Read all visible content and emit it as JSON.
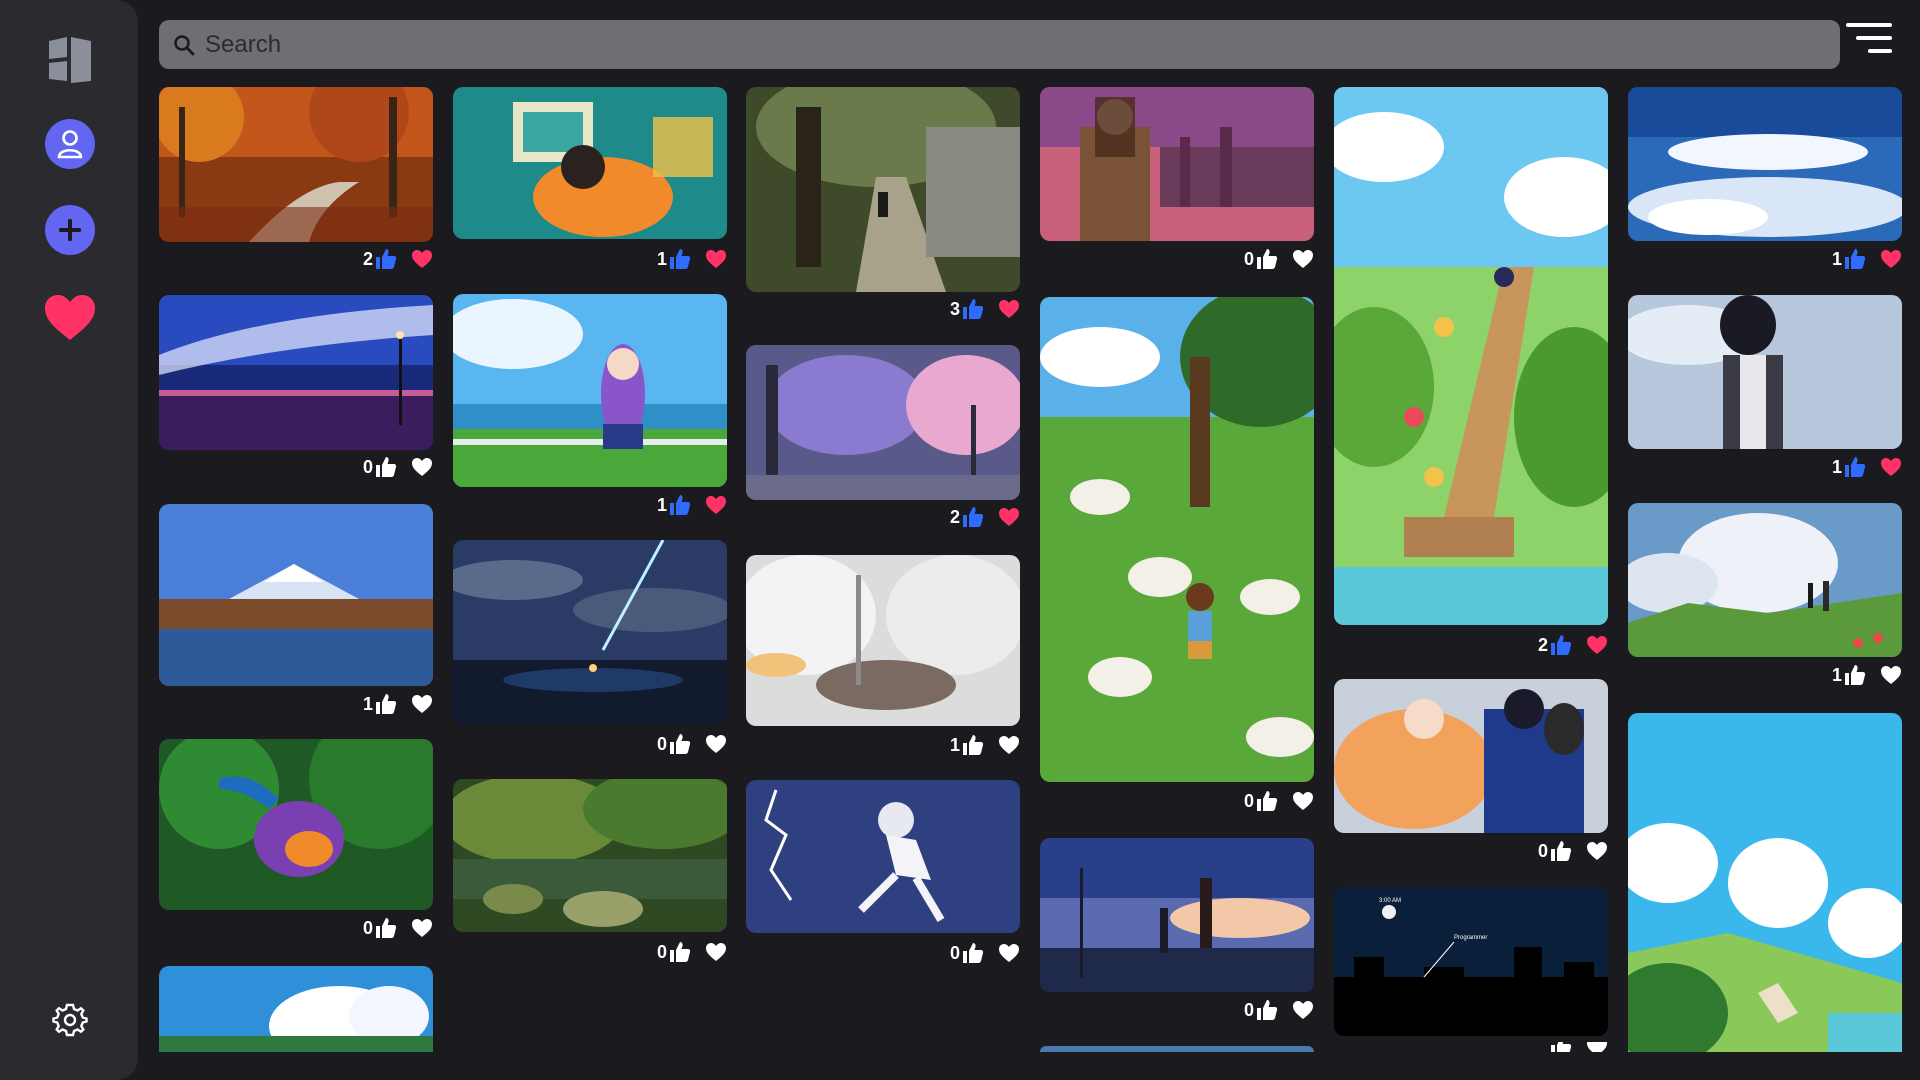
{
  "app": {
    "search_placeholder": "Search",
    "accent": "#6366f1",
    "heart_active": "#ff3366",
    "like_active": "#2f6bff"
  },
  "sidebar": {
    "items": [
      {
        "name": "logo-icon"
      },
      {
        "name": "profile-icon"
      },
      {
        "name": "add-icon"
      },
      {
        "name": "favorites-heart-icon"
      },
      {
        "name": "settings-gear-icon"
      }
    ]
  },
  "cards": [
    {
      "likes": "2",
      "liked": true,
      "favorited": true,
      "scene": "autumn park path"
    },
    {
      "likes": "0",
      "liked": false,
      "favorited": false,
      "scene": "starry evening sky"
    },
    {
      "likes": "1",
      "liked": false,
      "favorited": false,
      "scene": "mountain lake"
    },
    {
      "likes": "0",
      "liked": false,
      "favorited": false,
      "scene": "jungle bird"
    },
    {
      "likes": "",
      "liked": false,
      "favorited": false,
      "scene": "sky with clouds"
    },
    {
      "likes": "1",
      "liked": true,
      "favorited": true,
      "scene": "room with desk"
    },
    {
      "likes": "1",
      "liked": true,
      "favorited": true,
      "scene": "girl by the sea"
    },
    {
      "likes": "0",
      "liked": false,
      "favorited": false,
      "scene": "comet over town"
    },
    {
      "likes": "0",
      "liked": false,
      "favorited": false,
      "scene": "forest stream"
    },
    {
      "likes": "3",
      "liked": true,
      "favorited": true,
      "scene": "tree lined street"
    },
    {
      "likes": "2",
      "liked": true,
      "favorited": true,
      "scene": "railway crossing"
    },
    {
      "likes": "1",
      "liked": false,
      "favorited": false,
      "scene": "snowy forest"
    },
    {
      "likes": "0",
      "liked": false,
      "favorited": false,
      "scene": "lightning character"
    },
    {
      "likes": "0",
      "liked": false,
      "favorited": false,
      "scene": "city sunset"
    },
    {
      "likes": "0",
      "liked": false,
      "favorited": false,
      "scene": "hillside sheep"
    },
    {
      "likes": "0",
      "liked": false,
      "favorited": false,
      "scene": "power lines dusk"
    },
    {
      "likes": "",
      "liked": false,
      "favorited": false,
      "scene": "blue sky"
    },
    {
      "likes": "2",
      "liked": true,
      "favorited": true,
      "scene": "hill stairs"
    },
    {
      "likes": "0",
      "liked": false,
      "favorited": false,
      "scene": "winter couple"
    },
    {
      "likes": "",
      "liked": false,
      "favorited": false,
      "scene": "night skyline"
    },
    {
      "likes": "1",
      "liked": true,
      "favorited": true,
      "scene": "cloud sea"
    },
    {
      "likes": "1",
      "liked": true,
      "favorited": true,
      "scene": "boy in hoodie"
    },
    {
      "likes": "1",
      "liked": false,
      "favorited": false,
      "scene": "grassy hill clouds"
    },
    {
      "likes": "",
      "liked": false,
      "favorited": false,
      "scene": "coastal village"
    }
  ],
  "texts": {
    "night_time": "3:00 AM",
    "night_label": "Programmer"
  }
}
